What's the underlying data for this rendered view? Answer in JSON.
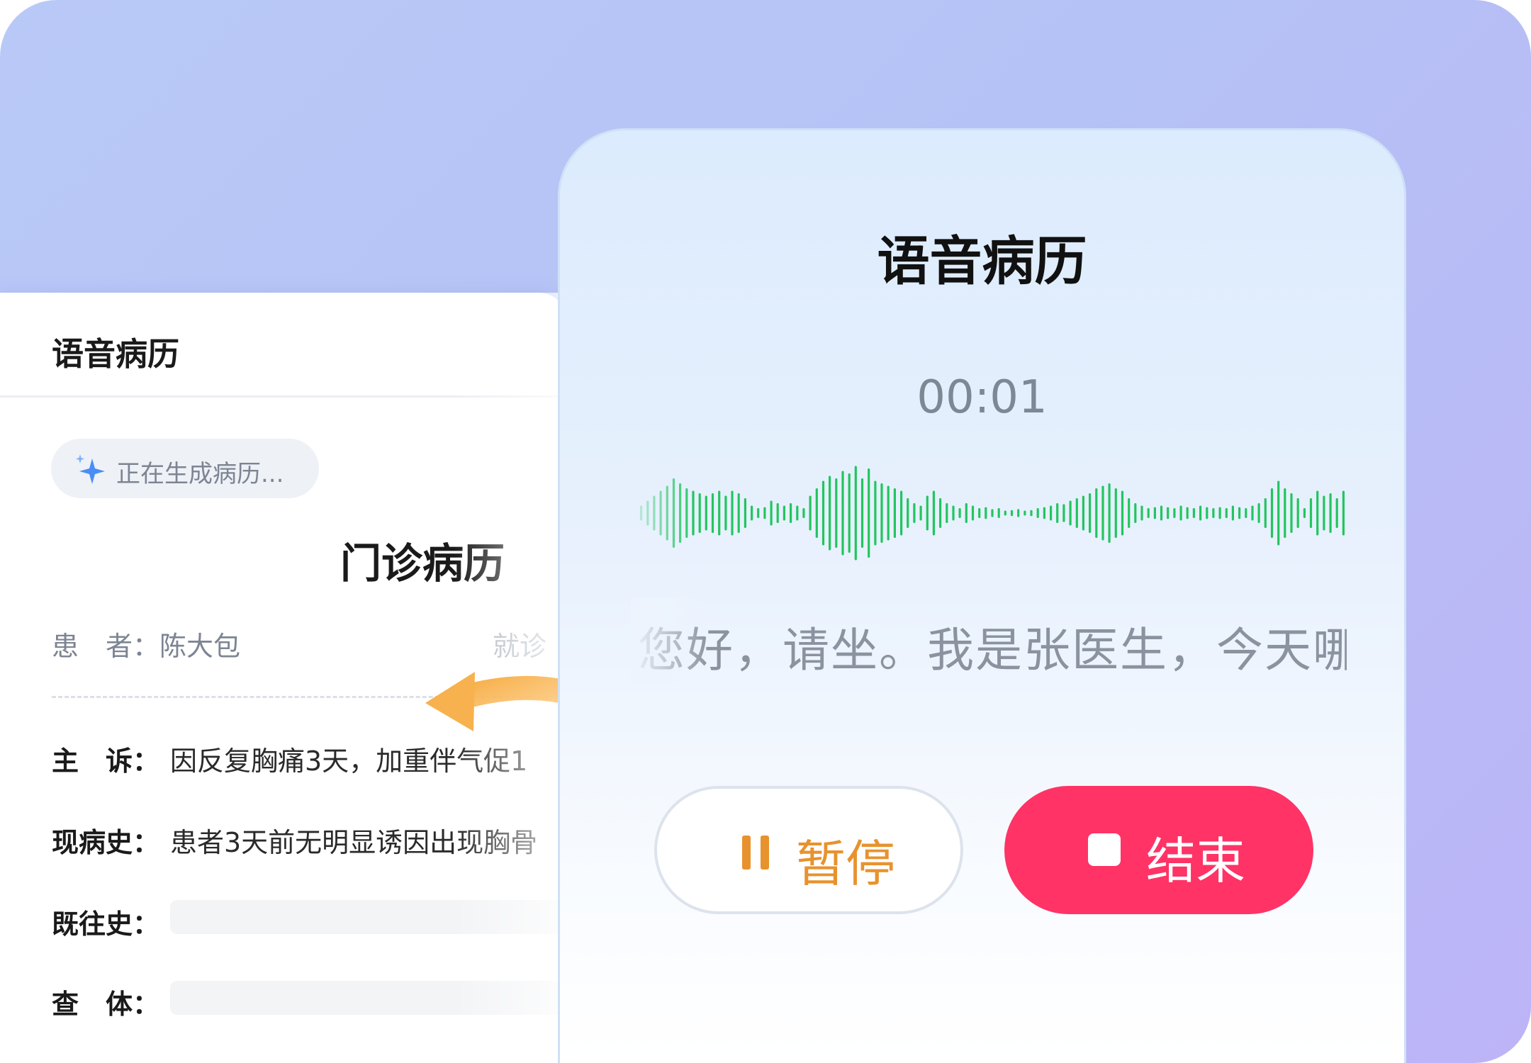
{
  "record_card": {
    "header_title": "语音病历",
    "generating_status": "正在生成病历...",
    "record_title": "门诊病历",
    "patient_label": "患　者：陈大包",
    "visit_label_partial": "就诊",
    "fields": [
      {
        "label": "主　诉：",
        "value": "因反复胸痛3天，加重伴气促1"
      },
      {
        "label": "现病史：",
        "value": "患者3天前无明显诱因出现胸骨"
      },
      {
        "label": "既往史：",
        "value": ""
      },
      {
        "label": "查　体：",
        "value": ""
      }
    ]
  },
  "voice_panel": {
    "title": "语音病历",
    "timer": "00:01",
    "transcript": "您好，请坐。我是张医生，今天哪",
    "pause_label": "暂停",
    "end_label": "结束",
    "waveform_levels": [
      0.15,
      0.25,
      0.35,
      0.45,
      0.55,
      0.7,
      0.6,
      0.5,
      0.45,
      0.4,
      0.35,
      0.4,
      0.45,
      0.35,
      0.45,
      0.4,
      0.3,
      0.15,
      0.1,
      0.12,
      0.25,
      0.2,
      0.15,
      0.2,
      0.15,
      0.1,
      0.35,
      0.5,
      0.65,
      0.75,
      0.7,
      0.85,
      0.8,
      0.95,
      0.7,
      0.9,
      0.65,
      0.6,
      0.55,
      0.5,
      0.45,
      0.3,
      0.2,
      0.15,
      0.35,
      0.45,
      0.3,
      0.2,
      0.15,
      0.1,
      0.2,
      0.15,
      0.1,
      0.12,
      0.08,
      0.1,
      0.05,
      0.06,
      0.08,
      0.05,
      0.06,
      0.1,
      0.12,
      0.15,
      0.2,
      0.18,
      0.25,
      0.3,
      0.35,
      0.4,
      0.5,
      0.55,
      0.6,
      0.5,
      0.45,
      0.3,
      0.2,
      0.15,
      0.1,
      0.12,
      0.15,
      0.12,
      0.1,
      0.15,
      0.12,
      0.1,
      0.15,
      0.12,
      0.1,
      0.12,
      0.1,
      0.15,
      0.12,
      0.1,
      0.15,
      0.2,
      0.3,
      0.5,
      0.65,
      0.5,
      0.4,
      0.3,
      0.1,
      0.3,
      0.45,
      0.35,
      0.4,
      0.3,
      0.45
    ],
    "colors": {
      "wave": "#22c55e",
      "end_button": "#ff3366",
      "pause_accent": "#e8922e"
    }
  }
}
